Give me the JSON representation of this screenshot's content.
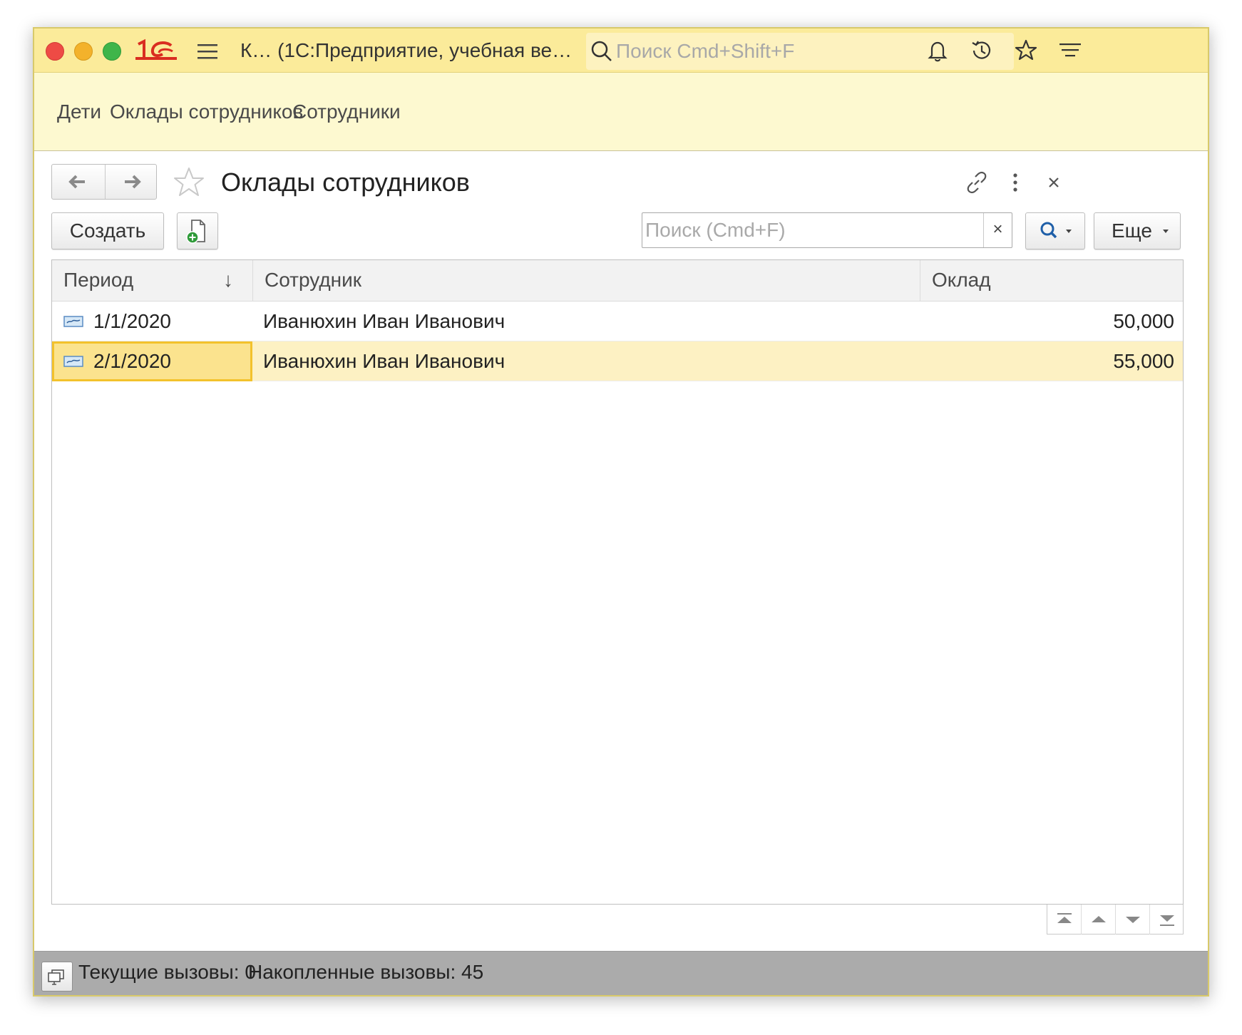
{
  "titlebar": {
    "app_title": "К… (1С:Предприятие, учебная ве…",
    "global_search_placeholder": "Поиск Cmd+Shift+F"
  },
  "sections": [
    "Дети",
    "Оклады сотрудников",
    "Сотрудники"
  ],
  "form": {
    "title": "Оклады сотрудников"
  },
  "commands": {
    "create_label": "Создать",
    "search_placeholder": "Поиск (Cmd+F)",
    "clear_label": "×",
    "more_label": "Еще"
  },
  "table": {
    "columns": [
      "Период",
      "Сотрудник",
      "Оклад"
    ],
    "sort_indicator": "↓",
    "rows": [
      {
        "period": "1/1/2020",
        "employee": "Иванюхин Иван Иванович",
        "salary": "50,000"
      },
      {
        "period": "2/1/2020",
        "employee": "Иванюхин Иван Иванович",
        "salary": "55,000"
      }
    ],
    "selected_row": 1
  },
  "status": {
    "current_calls": "Текущие вызовы: 0",
    "accumulated_calls": "Накопленные вызовы: 45"
  },
  "colors": {
    "titlebar_bg": "#fbeb9a",
    "sections_bg": "#fdf9d0",
    "selected_row_bg": "#fdf1c3",
    "active_cell_border": "#f3c22c",
    "statusbar_bg": "#ababab",
    "logo_red": "#d92d20"
  }
}
